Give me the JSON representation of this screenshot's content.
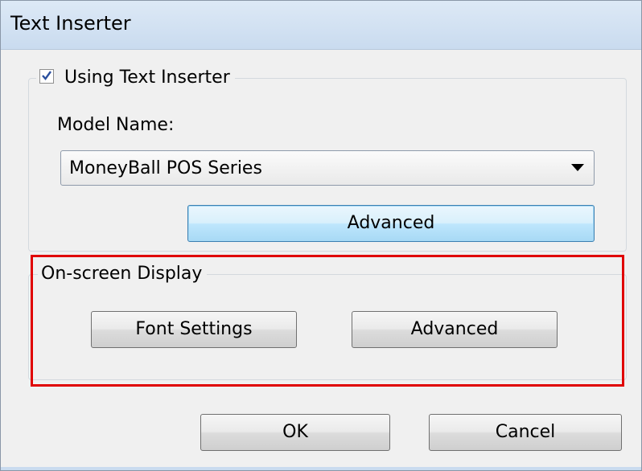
{
  "window": {
    "title": "Text Inserter"
  },
  "text_inserter_group": {
    "checkbox_label": "Using Text Inserter",
    "checkbox_checked": true,
    "model_label": "Model Name:",
    "model_value": "MoneyBall POS Series",
    "advanced_button": "Advanced"
  },
  "osd_group": {
    "title": "On-screen Display",
    "font_settings_button": "Font Settings",
    "advanced_button": "Advanced"
  },
  "footer": {
    "ok_button": "OK",
    "cancel_button": "Cancel"
  },
  "colors": {
    "highlight": "#e00000",
    "default_button_border": "#3c7fb1",
    "titlebar": "#c9dbef"
  },
  "icons": {
    "checkbox": "check-icon",
    "dropdown": "chevron-down-icon"
  }
}
